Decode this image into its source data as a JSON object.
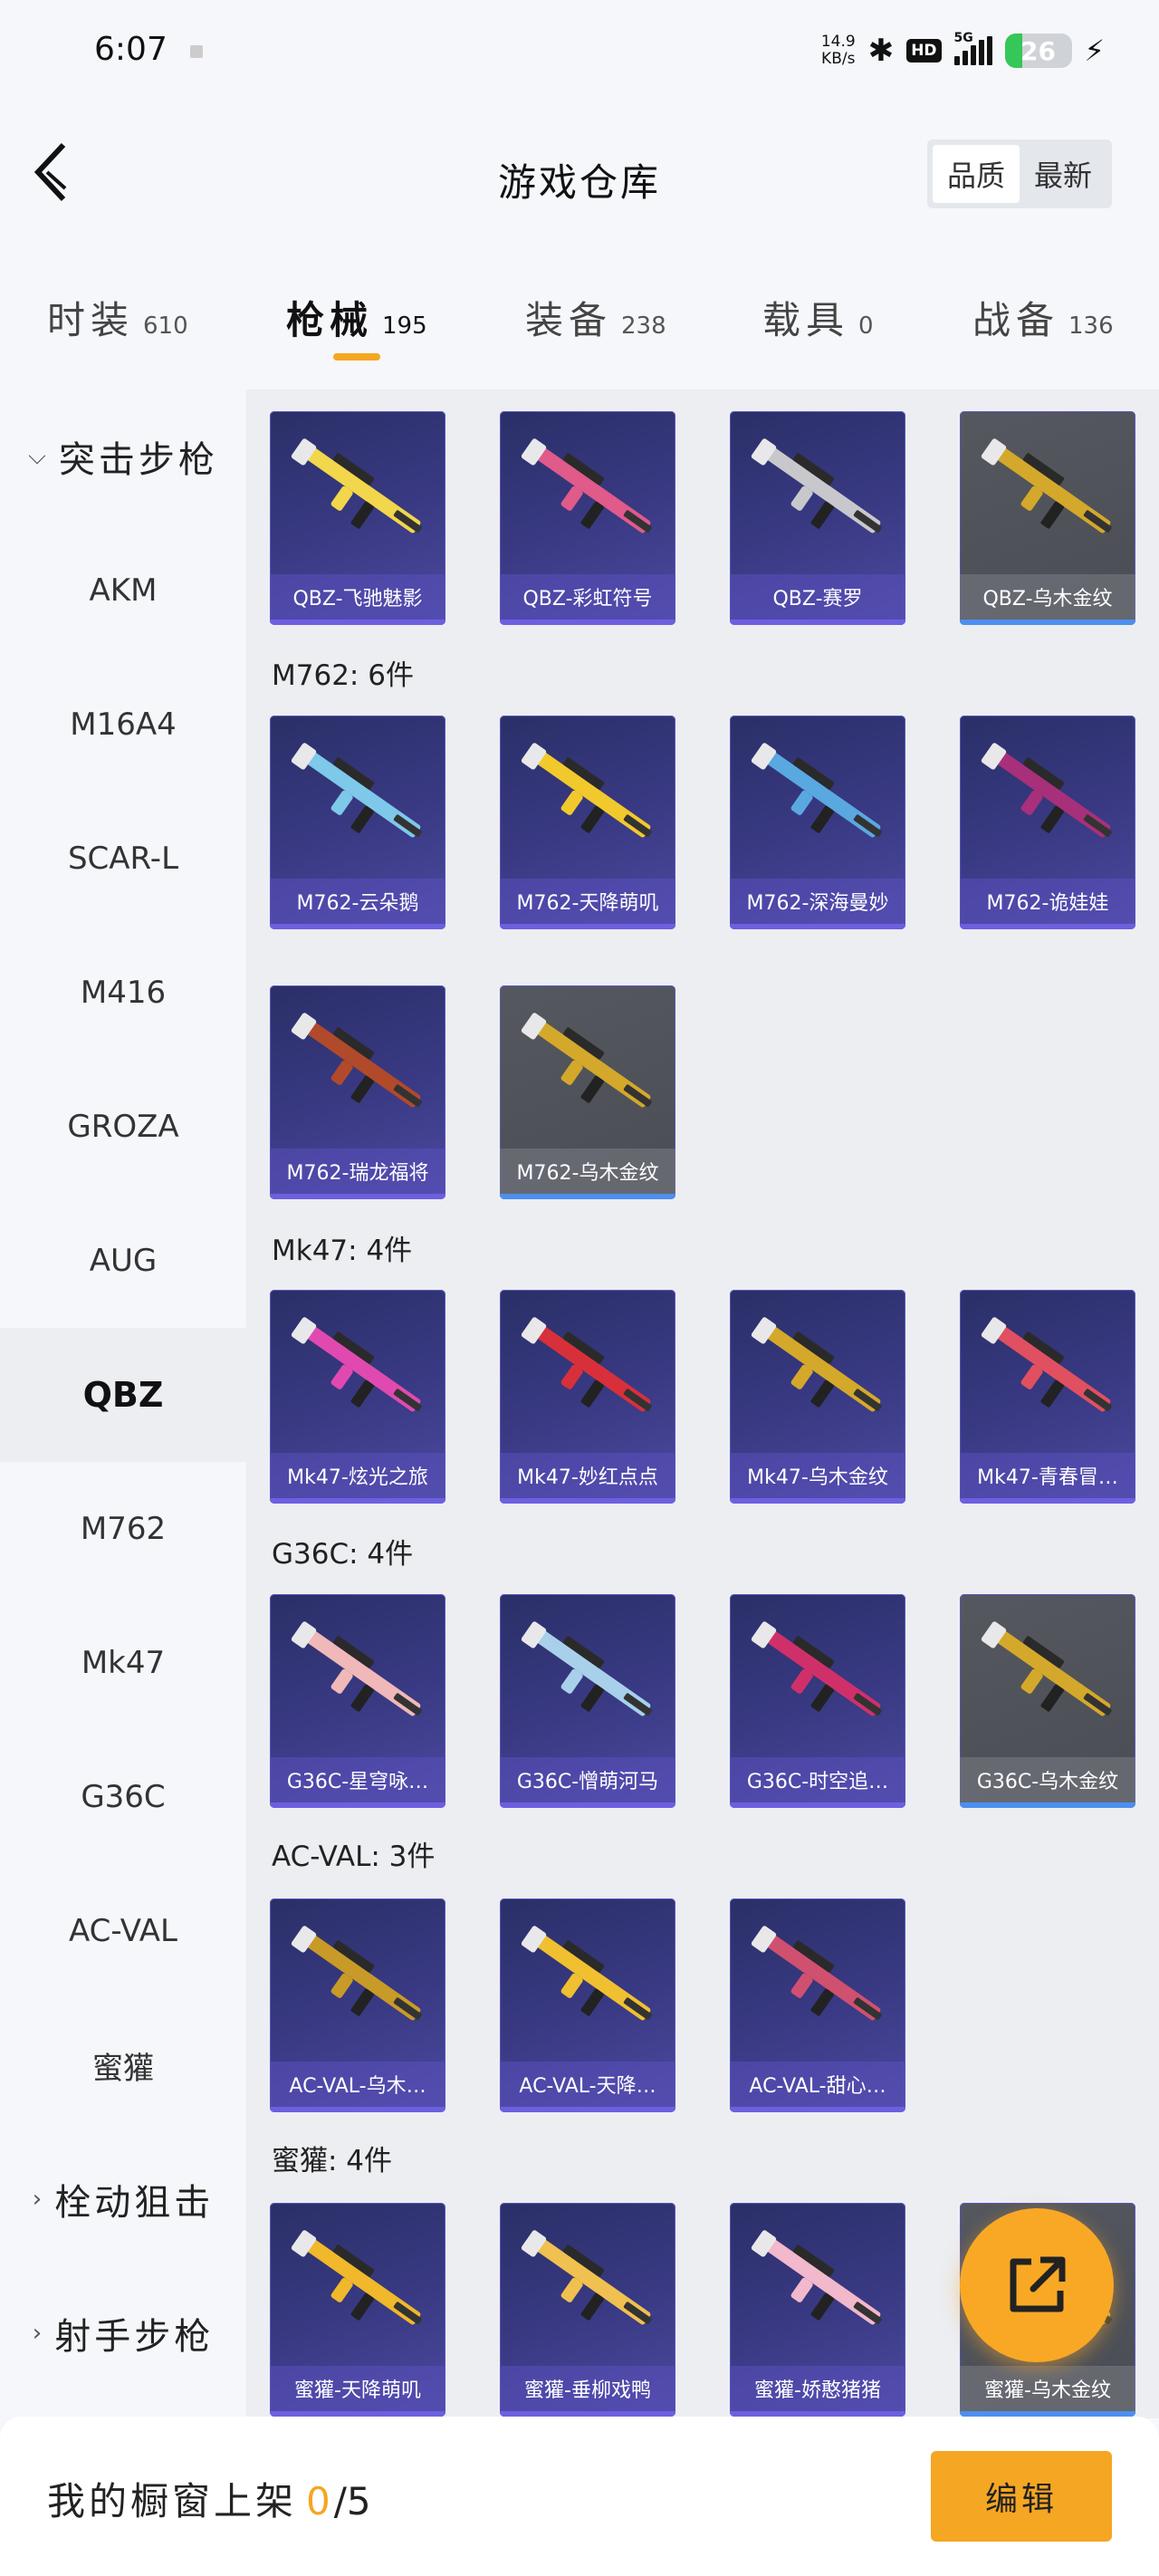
{
  "status_bar": {
    "time": "6:07",
    "net_speed_value": "14.9",
    "net_speed_unit": "KB/s",
    "network": "5G",
    "battery": "26"
  },
  "header": {
    "title": "游戏仓库",
    "sort_options": [
      "品质",
      "最新"
    ]
  },
  "tabs": [
    {
      "name": "时装",
      "count": "610"
    },
    {
      "name": "枪械",
      "count": "195"
    },
    {
      "name": "装备",
      "count": "238"
    },
    {
      "name": "载具",
      "count": "0"
    },
    {
      "name": "战备",
      "count": "136"
    }
  ],
  "sidebar": {
    "group_open": "突击步枪",
    "items": [
      "AKM",
      "M16A4",
      "SCAR-L",
      "M416",
      "GROZA",
      "AUG",
      "QBZ",
      "M762",
      "Mk47",
      "G36C",
      "AC-VAL",
      "蜜獾"
    ],
    "groups_closed": [
      "栓动狙击",
      "射手步枪"
    ]
  },
  "sections": {
    "qbz": {
      "items": [
        "QBZ-飞驰魅影",
        "QBZ-彩虹符号",
        "QBZ-赛罗",
        "QBZ-乌木金纹"
      ]
    },
    "m762": {
      "title": "M762: 6件",
      "items": [
        "M762-云朵鹅",
        "M762-天降萌叽",
        "M762-深海曼妙",
        "M762-诡娃娃",
        "M762-瑞龙福将",
        "M762-乌木金纹"
      ]
    },
    "mk47": {
      "title": "Mk47: 4件",
      "items": [
        "Mk47-炫光之旅",
        "Mk47-妙红点点",
        "Mk47-乌木金纹",
        "Mk47-青春冒…"
      ]
    },
    "g36c": {
      "title": "G36C: 4件",
      "items": [
        "G36C-星穹咏…",
        "G36C-憎萌河马",
        "G36C-时空追…",
        "G36C-乌木金纹"
      ]
    },
    "acval": {
      "title": "AC-VAL: 3件",
      "items": [
        "AC-VAL-乌木…",
        "AC-VAL-天降…",
        "AC-VAL-甜心…"
      ]
    },
    "honeybadger": {
      "title": "蜜獾: 4件",
      "items": [
        "蜜獾-天降萌叽",
        "蜜獾-垂柳戏鸭",
        "蜜獾-娇憨猪猪",
        "蜜獾-乌木金纹"
      ]
    }
  },
  "bottom_bar": {
    "label": "我的橱窗上架",
    "current": "0",
    "total": "/5",
    "edit_label": "编辑"
  },
  "colors": {
    "accent": "#f5a623",
    "card_purple": "#3a3a85",
    "card_grey": "#4a4d54"
  }
}
